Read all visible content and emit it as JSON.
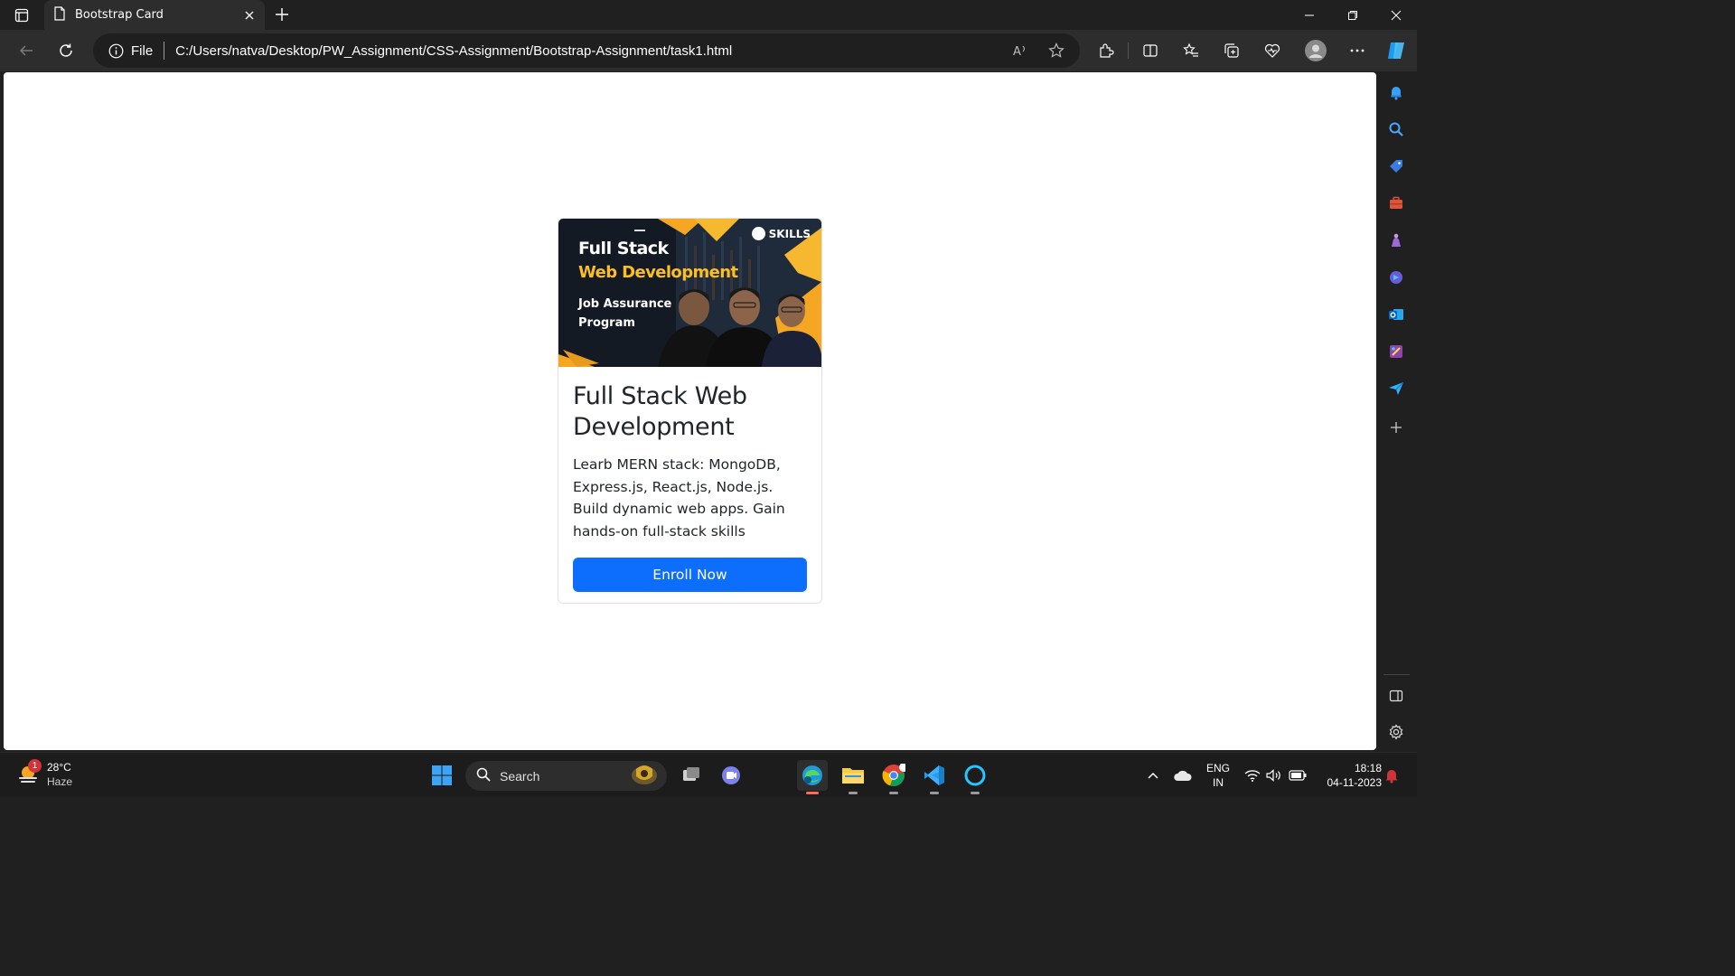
{
  "browser": {
    "tab_title": "Bootstrap Card",
    "address_prefix": "File",
    "url": "C:/Users/natva/Desktop/PW_Assignment/CSS-Assignment/Bootstrap-Assignment/task1.html"
  },
  "card": {
    "image": {
      "line1": "Full Stack",
      "line2": "Web Development",
      "line3": "Job Assurance Program",
      "logo": "SKILLS"
    },
    "title": "Full Stack Web Development",
    "text": "Learb MERN stack: MongoDB, Express.js, React.js, Node.js. Build dynamic web apps. Gain hands-on full-stack skills",
    "button_label": "Enroll Now"
  },
  "taskbar": {
    "weather_temp": "28°C",
    "weather_desc": "Haze",
    "weather_badge": "1",
    "search_placeholder": "Search",
    "lang_line1": "ENG",
    "lang_line2": "IN",
    "time": "18:18",
    "date": "04-11-2023"
  },
  "colors": {
    "primary": "#0d6efd",
    "banner_accent": "#fbbf24"
  }
}
